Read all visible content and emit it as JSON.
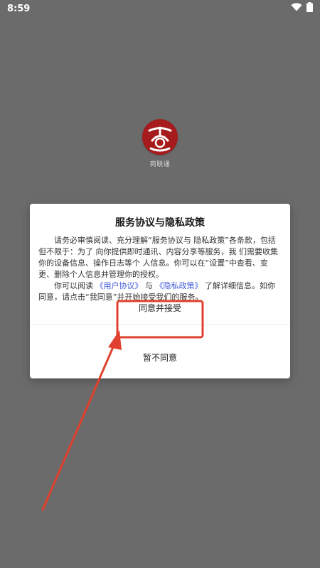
{
  "status_bar": {
    "time": "8:59"
  },
  "app": {
    "name": "商联通"
  },
  "dialog": {
    "title": "服务协议与隐私政策",
    "para1": "请务必审慎阅读、充分理解“服务协议与 隐私政策”各条款，包括但不限于：为了 向你提供即时通讯、内容分享等服务，我 们需要收集你的设备信息、操作日志等个 人信息。你可以在“设置”中查看、变更、删除个人信息并管理你的授权。",
    "para2_prefix": "你可以阅读",
    "user_agreement_link": "《用户协议》",
    "para2_and": "与",
    "privacy_policy_link": "《隐私政策》",
    "para2_suffix": "了解详细信息。如你同意，请点击“我同意”并开始接受我们的服务。",
    "agree_label": "同意并接受",
    "decline_label": "暂不同意"
  },
  "colors": {
    "background": "#6b6b6b",
    "annotation": "#e0412e",
    "link": "#4059d9",
    "logo": "#a61b1b"
  }
}
